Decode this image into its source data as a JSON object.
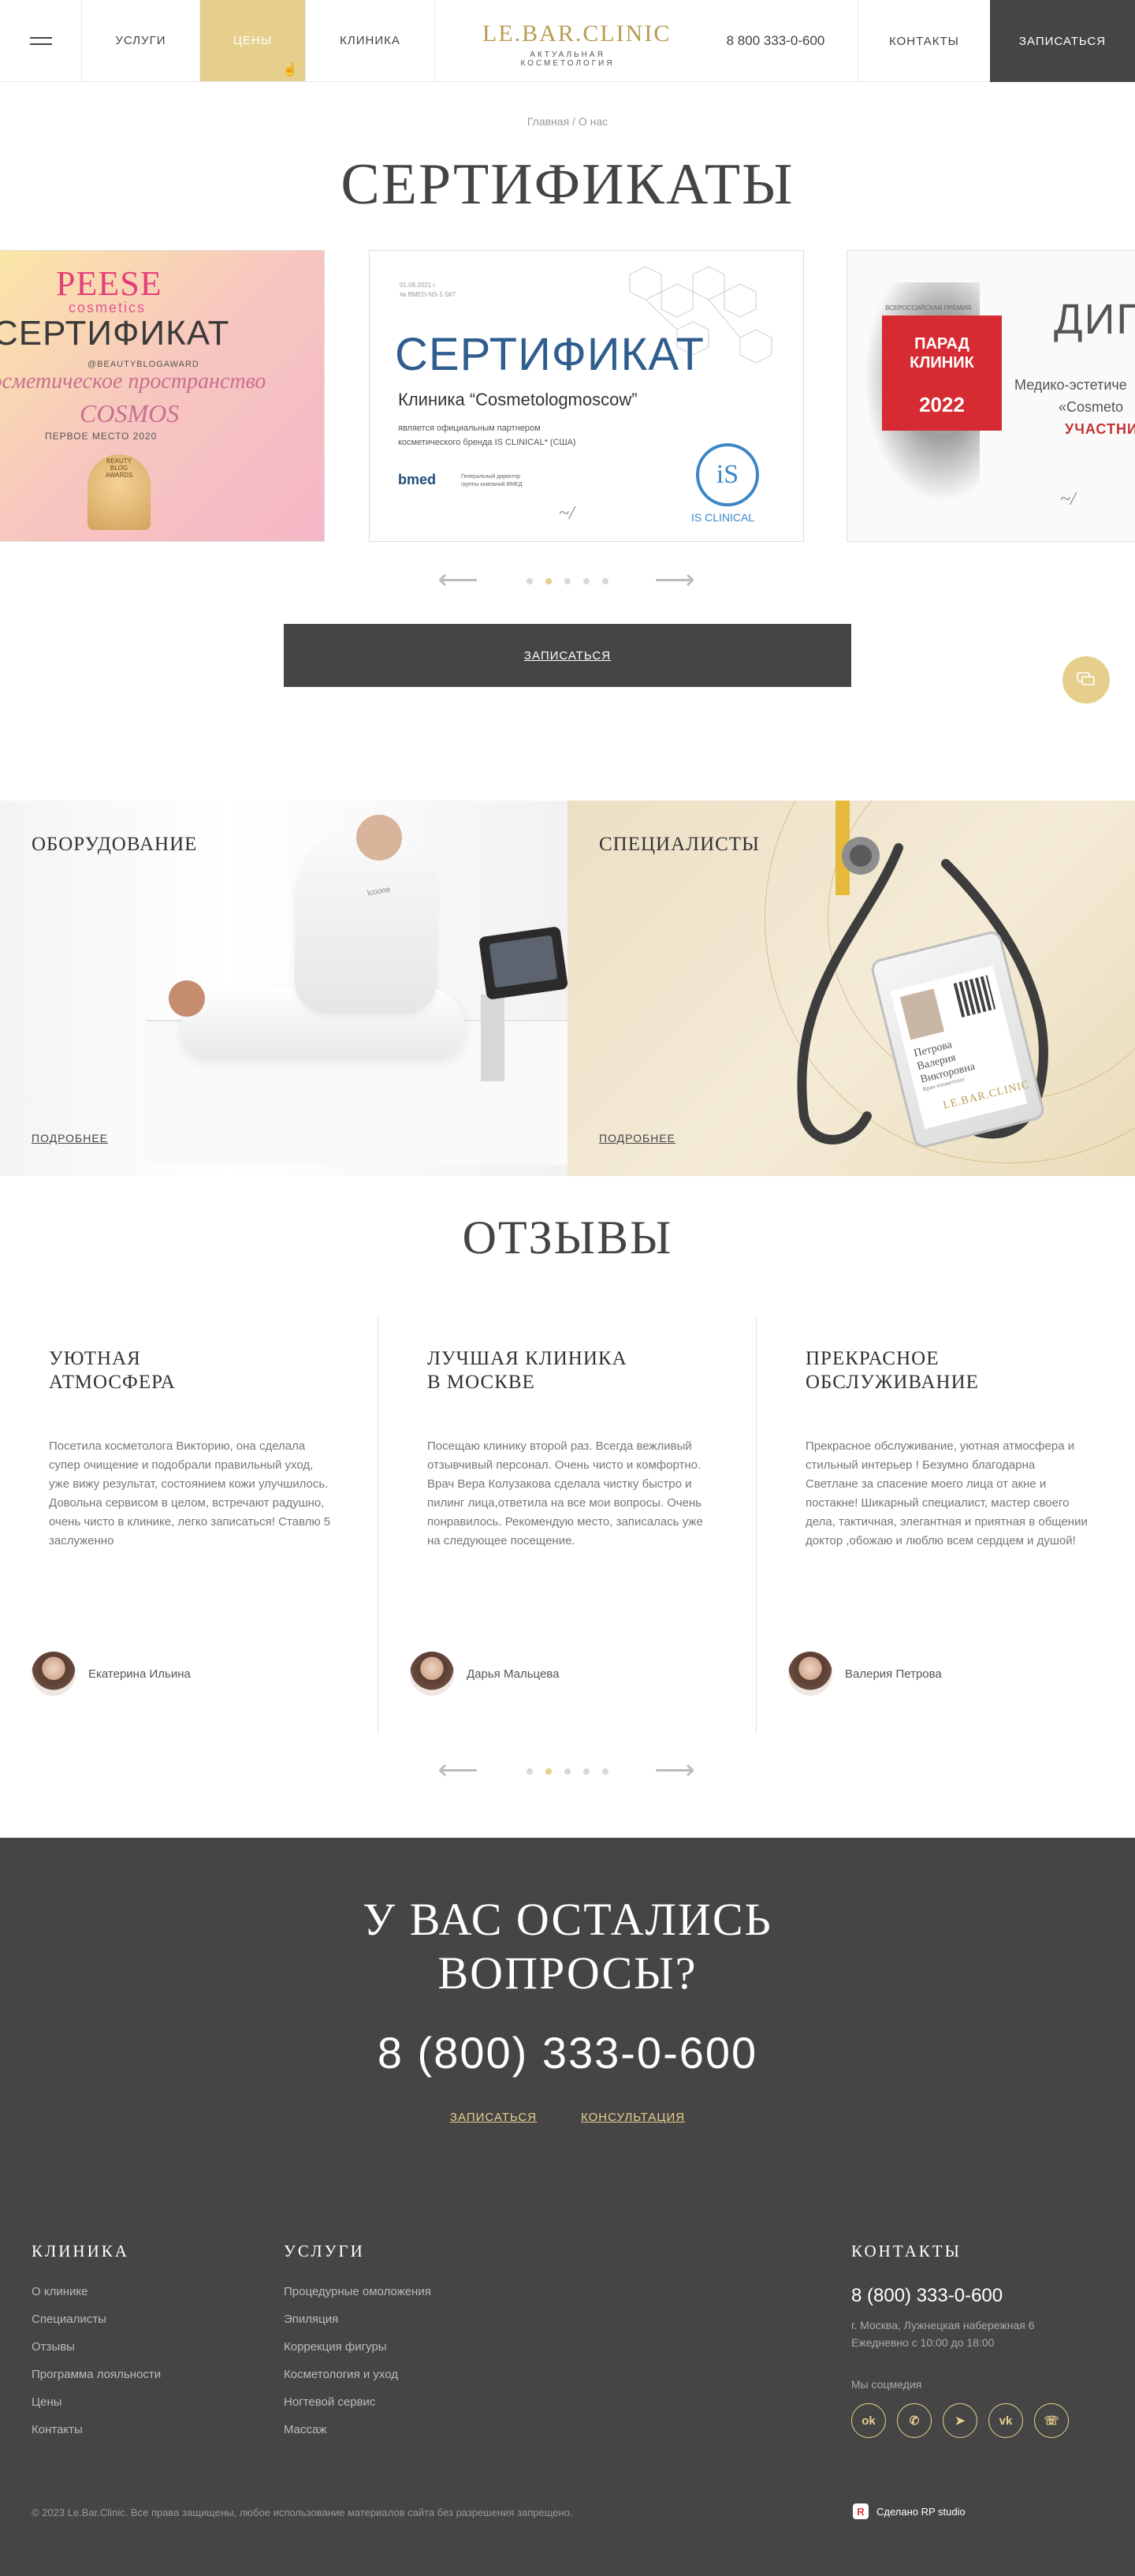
{
  "header": {
    "nav": [
      "Услуги",
      "Цены",
      "Клиника"
    ],
    "logo_main": "LE.BAR.CLINIC",
    "logo_sub": "АКТУАЛЬНАЯ КОСМЕТОЛОГИЯ",
    "phone": "8 800 333-0-600",
    "contacts": "КОНТАКТЫ",
    "book": "ЗАПИСАТЬСЯ"
  },
  "breadcrumb": "Главная / О нас",
  "certificates": {
    "title": "СЕРТИФИКАТЫ",
    "cert1": {
      "brand": "PEESE",
      "brand_sub": "cosmetics",
      "title": "СЕРТИФИКАТ",
      "handle": "@BEAUTYBLOGAWARD",
      "script1": "Косметическое пространство",
      "script2": "COSMOS",
      "place": "ПЕРВОЕ МЕСТО 2020",
      "badge": "BEAUTY BLOG AWARDS"
    },
    "cert2": {
      "small": "01.08.2021 г.\n№ BMED-NS-1-567",
      "title": "СЕРТИФИКАТ",
      "clinic": "Клиника “Cosmetologmoscow”",
      "text": "является официальным партнером\nкосметического бренда IS CLINICAL* (США)",
      "bmed": "bmed",
      "bmed_sub": "Генеральный директор\nгруппы компаний ВМЕД",
      "isc_logo": "iS",
      "isc_text": "IS CLINICAL"
    },
    "cert3": {
      "small": "ВСЕРОССИЙСКАЯ ПРЕМИЯ",
      "badge_l1": "ПАРАД",
      "badge_l2": "КЛИНИК",
      "badge_year": "2022",
      "title": "ДИП",
      "line1": "Медико-эстетиче",
      "line2": "«Cosmeto",
      "participant": "УЧАСТНИК"
    },
    "button": "ЗАПИСАТЬСЯ"
  },
  "tiles": {
    "equipment": {
      "title": "ОБОРУДОВАНИЕ",
      "more": "ПОДРОБНЕЕ",
      "device_label": "lcoone"
    },
    "specialists": {
      "title": "СПЕЦИАЛИСТЫ",
      "more": "ПОДРОБНЕЕ",
      "badge_name": "Петрова\nВалерия\nВикторовна",
      "badge_role": "Врач-косметолог",
      "badge_logo": "LE.BAR.CLINIC"
    }
  },
  "reviews": {
    "title": "ОТЗЫВЫ",
    "items": [
      {
        "title": "УЮТНАЯ\nАТМОСФЕРА",
        "text": "Посетила косметолога Викторию, она сделала супер очищение и подобрали правильный уход, уже вижу результат, состоянием кожи улучшилось. Довольна сервисом в целом, встречают радушно, очень чисто в клинике, легко записаться! Ставлю 5 заслуженно",
        "author": "Екатерина Ильина"
      },
      {
        "title": "ЛУЧШАЯ КЛИНИКА\nВ МОСКВЕ",
        "text": "Посещаю клинику второй раз. Всегда вежливый отзывчивый персонал. Очень чисто и комфортно. Врач Вера Колузакова сделала чистку быстро и пилинг лица,ответила на все мои вопросы. Очень понравилось. Рекомендую место, записалась уже на следующее посещение.",
        "author": "Дарья Мальцева"
      },
      {
        "title": "ПРЕКРАСНОЕ\nОБСЛУЖИВАНИЕ",
        "text": "Прекрасное обслуживание, уютная атмосфера и стильный интерьер ! Безумно благодарна Светлане за спасение моего лица от акне и постакне! Шикарный специалист, мастер своего дела, тактичная, элегантная и приятная в общении доктор ,обожаю и люблю всем сердцем и душой!",
        "author": "Валерия Петрова"
      }
    ]
  },
  "slider": {
    "dots": 5,
    "active": 1
  },
  "footer": {
    "question": "У ВАС ОСТАЛИСЬ\nВОПРОСЫ?",
    "phone": "8 (800) 333-0-600",
    "book_link": "ЗАПИСАТЬСЯ",
    "consult_link": "КОНСУЛЬТАЦИЯ",
    "clinic": {
      "title": "КЛИНИКА",
      "items": [
        "О клинике",
        "Специалисты",
        "Отзывы",
        "Программа лояльности",
        "Цены",
        "Контакты"
      ]
    },
    "services": {
      "title": "УСЛУГИ",
      "items": [
        "Процедурные омоложения",
        "Эпиляция",
        "Коррекция фигуры",
        "Косметология и уход",
        "Ногтевой сервис",
        "Массаж"
      ]
    },
    "contacts": {
      "title": "КОНТАКТЫ",
      "phone": "8 (800) 333-0-600",
      "address": "г. Москва, Лужнецкая набережная 6",
      "hours": "Ежедневно с 10:00 до 18:00",
      "social_label": "Мы соцмедия",
      "social": [
        "ok",
        "viber",
        "telegram",
        "vk",
        "whatsapp"
      ]
    },
    "copyright": "© 2023 Le.Bar.Clinic. Все права защищены, любое использование материалов сайта без разрешения запрещено.",
    "made_by": "Сделано RP studio"
  },
  "colors": {
    "accent": "#e6cf8d",
    "dark": "#464545",
    "text": "#444444"
  }
}
